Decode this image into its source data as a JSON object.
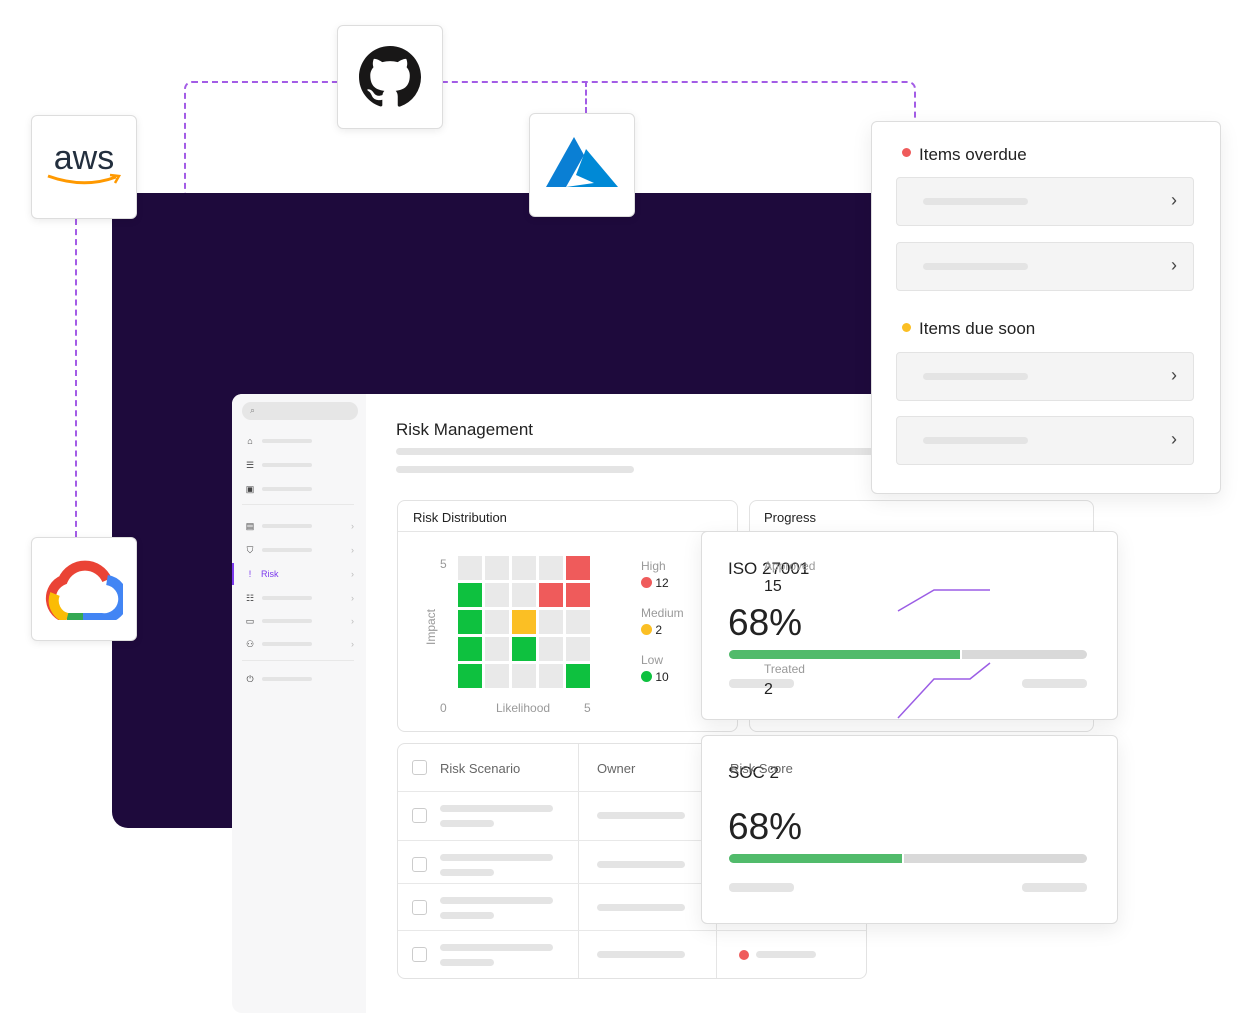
{
  "integrations": [
    {
      "name": "aws",
      "label": "aws"
    },
    {
      "name": "github"
    },
    {
      "name": "azure"
    },
    {
      "name": "google-cloud"
    }
  ],
  "sidebar": {
    "items": [
      {
        "icon": "home-icon"
      },
      {
        "icon": "checklist-icon"
      },
      {
        "icon": "report-icon"
      },
      {
        "icon": "clipboard-icon"
      },
      {
        "icon": "shield-icon"
      },
      {
        "icon": "risk-icon",
        "label": "Risk",
        "active": true
      },
      {
        "icon": "database-icon"
      },
      {
        "icon": "monitor-icon"
      },
      {
        "icon": "users-icon"
      },
      {
        "icon": "plug-icon"
      }
    ]
  },
  "main": {
    "title": "Risk Management"
  },
  "risk_distribution": {
    "title": "Risk Distribution",
    "y_label": "Impact",
    "x_label": "Likelihood",
    "y_max": "5",
    "x_min": "0",
    "x_max": "5",
    "matrix": [
      [
        "n",
        "n",
        "n",
        "n",
        "h"
      ],
      [
        "l",
        "n",
        "n",
        "h",
        "h"
      ],
      [
        "l",
        "n",
        "m",
        "n",
        "n"
      ],
      [
        "l",
        "n",
        "l",
        "n",
        "n"
      ],
      [
        "l",
        "n",
        "n",
        "n",
        "l"
      ]
    ],
    "legend": [
      {
        "label": "High",
        "count": "12",
        "color": "#ef5b5b"
      },
      {
        "label": "Medium",
        "count": "2",
        "color": "#fbbf24"
      },
      {
        "label": "Low",
        "count": "10",
        "color": "#0ec13f"
      }
    ]
  },
  "progress": {
    "title": "Progress",
    "items": [
      {
        "label": "Approved",
        "value": "15"
      },
      {
        "label": "Treated",
        "value": "2"
      }
    ]
  },
  "table": {
    "headers": [
      "Risk Scenario",
      "Owner",
      "Risk Score"
    ],
    "row_scores": [
      "#ef5b5b",
      "#0ec13f",
      "#fbbf24",
      "#ef5b5b"
    ]
  },
  "items_panel": {
    "overdue": {
      "label": "Items overdue",
      "color": "#ef5b5b"
    },
    "due_soon": {
      "label": "Items due soon",
      "color": "#fbbf24"
    }
  },
  "frameworks": [
    {
      "name": "ISO 27001",
      "percent": "68%",
      "fill": 0.65
    },
    {
      "name": "SOC 2",
      "percent": "68%",
      "fill": 0.49
    }
  ]
}
